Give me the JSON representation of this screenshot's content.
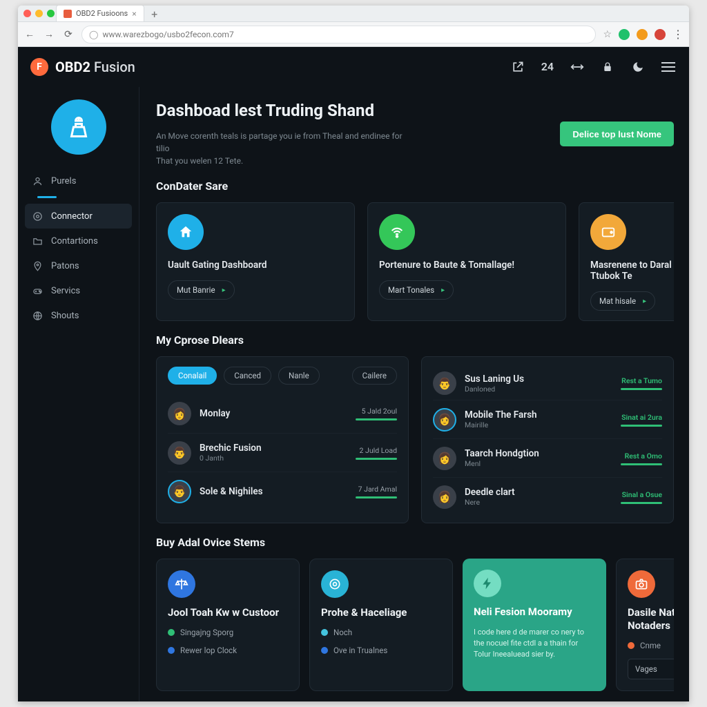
{
  "browser": {
    "tab_title": "OBD2 Fusioons",
    "url": "www.warezbogo/usbo2fecon.com7",
    "badge_number": "24"
  },
  "brand": {
    "logo_letter": "F",
    "name_bold": "OBD2",
    "name_thin": " Fusion"
  },
  "sidebar": {
    "items": [
      {
        "label": "Purels"
      },
      {
        "label": "Connector"
      },
      {
        "label": "Contartions"
      },
      {
        "label": "Patons"
      },
      {
        "label": "Servics"
      },
      {
        "label": "Shouts"
      }
    ]
  },
  "page": {
    "title": "Dashboad lest Truding Shand",
    "sub_line1": "An Move corenth teals is partage you ie from Theal and endinee for tilio",
    "sub_line2": "That you welen 12 Tete.",
    "cta": "Delice top lust Nome"
  },
  "condater": {
    "heading": "ConDater Sare",
    "cards": [
      {
        "title": "Uault Gating Dashboard",
        "pill": "Mut Banrie",
        "color": "b-blue"
      },
      {
        "title": "Portenure to Baute & Tomallage!",
        "pill": "Mart Tonales",
        "color": "b-green"
      },
      {
        "title": "Masrenene to Daral Ttubok Te",
        "pill": "Mat hisale",
        "color": "b-orange"
      }
    ]
  },
  "dears": {
    "heading": "My Cprose Dlears",
    "filters": [
      "Conalail",
      "Canced",
      "Nanle",
      "Cailere"
    ],
    "left": [
      {
        "name": "Monlay",
        "sub": "",
        "meta": "5 Jald 2oul",
        "ring": false
      },
      {
        "name": "Brechic Fusion",
        "sub": "0 Janth",
        "meta": "2 Juld Load",
        "ring": false
      },
      {
        "name": "Sole & Nighiles",
        "sub": "",
        "meta": "7 Jard Amal",
        "ring": true
      }
    ],
    "right": [
      {
        "name": "Sus Laning Us",
        "sub": "Danloned",
        "meta": "Rest a Tumo",
        "ring": false,
        "green": true
      },
      {
        "name": "Mobile The Farsh",
        "sub": "Mairille",
        "meta": "Sinat ai 2ura",
        "ring": true,
        "green": true
      },
      {
        "name": "Taarch Hondgtion",
        "sub": "Menl",
        "meta": "Rest a Omo",
        "ring": false,
        "green": true
      },
      {
        "name": "Deedle clart",
        "sub": "Nere",
        "meta": "Sinal a Osue",
        "ring": false,
        "green": true
      }
    ]
  },
  "stems": {
    "heading": "Buy Adal Ovice Stems",
    "cards": [
      {
        "style": "dark",
        "badge": "sb-blue",
        "title": "Jool Toah Kw w Custoor",
        "rows": [
          {
            "dot": "d-green",
            "label": "Singajng Sporg"
          },
          {
            "dot": "d-blue",
            "label": "Rewer lop Clock"
          }
        ]
      },
      {
        "style": "dark",
        "badge": "sb-cyan",
        "title": "Prohe & Haceliage",
        "rows": [
          {
            "dot": "d-cyan",
            "label": "Noch"
          },
          {
            "dot": "d-blue",
            "label": "Ove in Trualnes"
          }
        ]
      },
      {
        "style": "teal",
        "badge": "sb-mint",
        "title": "Neli Fesion Mooramy",
        "desc": "I code here d de marer co nery to the nocuel fite ctdl a a thain for Tolur Ineealuead sier by."
      },
      {
        "style": "dark",
        "badge": "sb-orange",
        "title": "Dasile Nation & Notaders",
        "rows": [
          {
            "dot": "d-orange",
            "label": "Cnme"
          }
        ],
        "select": "Vages"
      }
    ]
  }
}
